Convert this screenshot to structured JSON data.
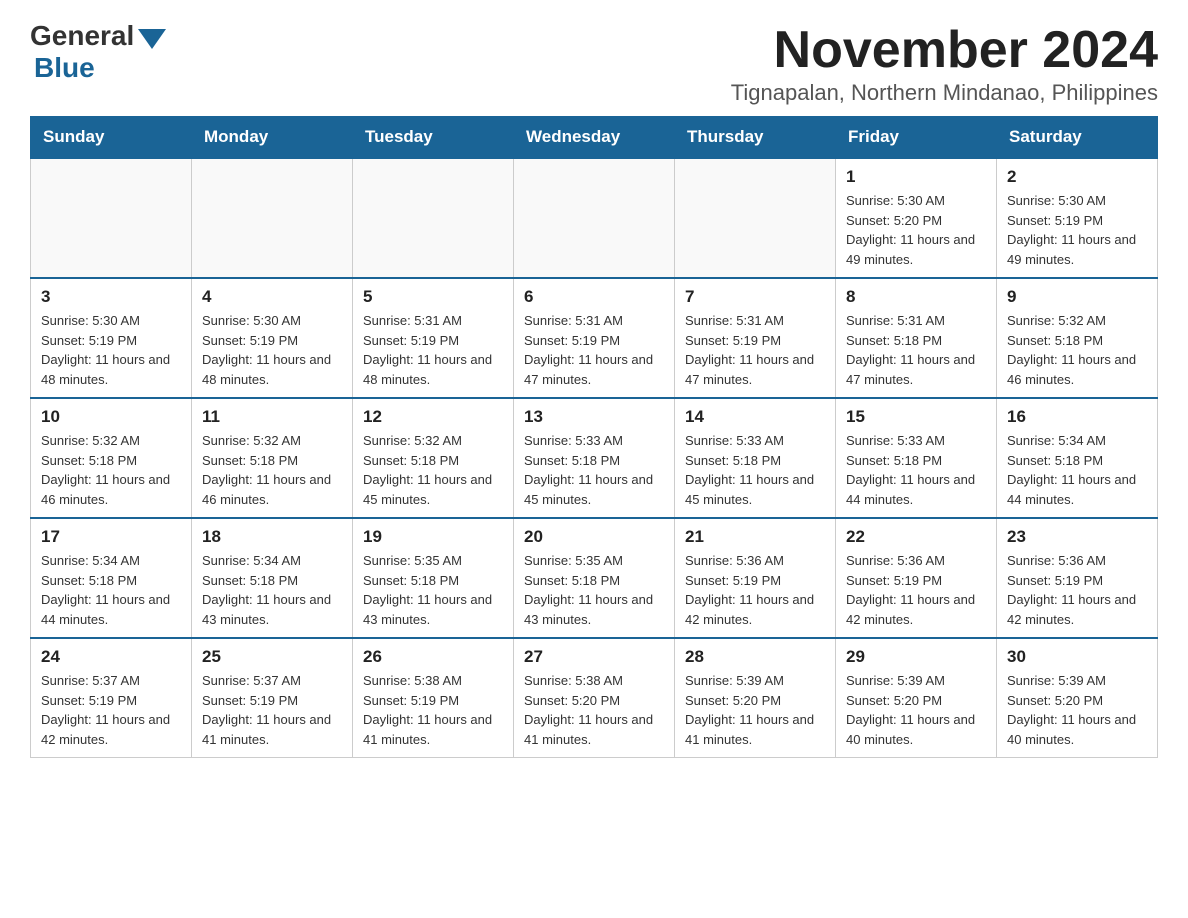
{
  "logo": {
    "general": "General",
    "blue": "Blue"
  },
  "header": {
    "month_title": "November 2024",
    "location": "Tignapalan, Northern Mindanao, Philippines"
  },
  "days_of_week": [
    "Sunday",
    "Monday",
    "Tuesday",
    "Wednesday",
    "Thursday",
    "Friday",
    "Saturday"
  ],
  "weeks": [
    {
      "days": [
        {
          "date": "",
          "info": ""
        },
        {
          "date": "",
          "info": ""
        },
        {
          "date": "",
          "info": ""
        },
        {
          "date": "",
          "info": ""
        },
        {
          "date": "",
          "info": ""
        },
        {
          "date": "1",
          "info": "Sunrise: 5:30 AM\nSunset: 5:20 PM\nDaylight: 11 hours and 49 minutes."
        },
        {
          "date": "2",
          "info": "Sunrise: 5:30 AM\nSunset: 5:19 PM\nDaylight: 11 hours and 49 minutes."
        }
      ]
    },
    {
      "days": [
        {
          "date": "3",
          "info": "Sunrise: 5:30 AM\nSunset: 5:19 PM\nDaylight: 11 hours and 48 minutes."
        },
        {
          "date": "4",
          "info": "Sunrise: 5:30 AM\nSunset: 5:19 PM\nDaylight: 11 hours and 48 minutes."
        },
        {
          "date": "5",
          "info": "Sunrise: 5:31 AM\nSunset: 5:19 PM\nDaylight: 11 hours and 48 minutes."
        },
        {
          "date": "6",
          "info": "Sunrise: 5:31 AM\nSunset: 5:19 PM\nDaylight: 11 hours and 47 minutes."
        },
        {
          "date": "7",
          "info": "Sunrise: 5:31 AM\nSunset: 5:19 PM\nDaylight: 11 hours and 47 minutes."
        },
        {
          "date": "8",
          "info": "Sunrise: 5:31 AM\nSunset: 5:18 PM\nDaylight: 11 hours and 47 minutes."
        },
        {
          "date": "9",
          "info": "Sunrise: 5:32 AM\nSunset: 5:18 PM\nDaylight: 11 hours and 46 minutes."
        }
      ]
    },
    {
      "days": [
        {
          "date": "10",
          "info": "Sunrise: 5:32 AM\nSunset: 5:18 PM\nDaylight: 11 hours and 46 minutes."
        },
        {
          "date": "11",
          "info": "Sunrise: 5:32 AM\nSunset: 5:18 PM\nDaylight: 11 hours and 46 minutes."
        },
        {
          "date": "12",
          "info": "Sunrise: 5:32 AM\nSunset: 5:18 PM\nDaylight: 11 hours and 45 minutes."
        },
        {
          "date": "13",
          "info": "Sunrise: 5:33 AM\nSunset: 5:18 PM\nDaylight: 11 hours and 45 minutes."
        },
        {
          "date": "14",
          "info": "Sunrise: 5:33 AM\nSunset: 5:18 PM\nDaylight: 11 hours and 45 minutes."
        },
        {
          "date": "15",
          "info": "Sunrise: 5:33 AM\nSunset: 5:18 PM\nDaylight: 11 hours and 44 minutes."
        },
        {
          "date": "16",
          "info": "Sunrise: 5:34 AM\nSunset: 5:18 PM\nDaylight: 11 hours and 44 minutes."
        }
      ]
    },
    {
      "days": [
        {
          "date": "17",
          "info": "Sunrise: 5:34 AM\nSunset: 5:18 PM\nDaylight: 11 hours and 44 minutes."
        },
        {
          "date": "18",
          "info": "Sunrise: 5:34 AM\nSunset: 5:18 PM\nDaylight: 11 hours and 43 minutes."
        },
        {
          "date": "19",
          "info": "Sunrise: 5:35 AM\nSunset: 5:18 PM\nDaylight: 11 hours and 43 minutes."
        },
        {
          "date": "20",
          "info": "Sunrise: 5:35 AM\nSunset: 5:18 PM\nDaylight: 11 hours and 43 minutes."
        },
        {
          "date": "21",
          "info": "Sunrise: 5:36 AM\nSunset: 5:19 PM\nDaylight: 11 hours and 42 minutes."
        },
        {
          "date": "22",
          "info": "Sunrise: 5:36 AM\nSunset: 5:19 PM\nDaylight: 11 hours and 42 minutes."
        },
        {
          "date": "23",
          "info": "Sunrise: 5:36 AM\nSunset: 5:19 PM\nDaylight: 11 hours and 42 minutes."
        }
      ]
    },
    {
      "days": [
        {
          "date": "24",
          "info": "Sunrise: 5:37 AM\nSunset: 5:19 PM\nDaylight: 11 hours and 42 minutes."
        },
        {
          "date": "25",
          "info": "Sunrise: 5:37 AM\nSunset: 5:19 PM\nDaylight: 11 hours and 41 minutes."
        },
        {
          "date": "26",
          "info": "Sunrise: 5:38 AM\nSunset: 5:19 PM\nDaylight: 11 hours and 41 minutes."
        },
        {
          "date": "27",
          "info": "Sunrise: 5:38 AM\nSunset: 5:20 PM\nDaylight: 11 hours and 41 minutes."
        },
        {
          "date": "28",
          "info": "Sunrise: 5:39 AM\nSunset: 5:20 PM\nDaylight: 11 hours and 41 minutes."
        },
        {
          "date": "29",
          "info": "Sunrise: 5:39 AM\nSunset: 5:20 PM\nDaylight: 11 hours and 40 minutes."
        },
        {
          "date": "30",
          "info": "Sunrise: 5:39 AM\nSunset: 5:20 PM\nDaylight: 11 hours and 40 minutes."
        }
      ]
    }
  ],
  "accent_color": "#1a6496"
}
